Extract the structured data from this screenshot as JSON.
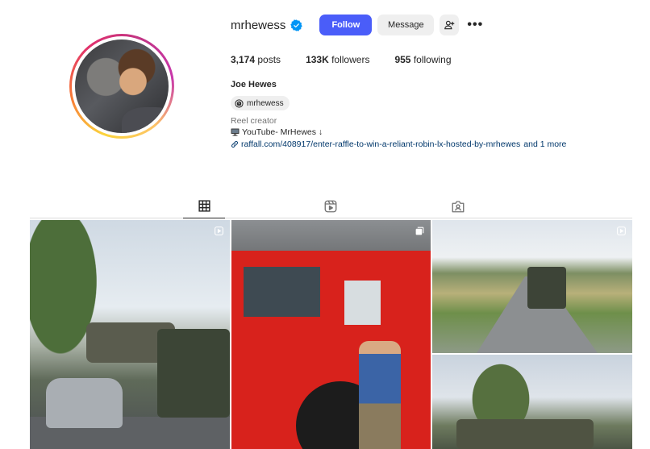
{
  "profile": {
    "username": "mrhewess",
    "full_name": "Joe Hewes",
    "threads_handle": "mrhewess",
    "category": "Reel creator",
    "bio_line": "YouTube- MrHewes ↓",
    "link": "raffall.com/408917/enter-raffle-to-win-a-reliant-robin-lx-hosted-by-mrhewes",
    "link_more": "and 1 more"
  },
  "buttons": {
    "follow": "Follow",
    "message": "Message"
  },
  "stats": {
    "posts_count": "3,174",
    "posts_label": "posts",
    "followers_count": "133K",
    "followers_label": "followers",
    "following_count": "955",
    "following_label": "following"
  },
  "tabs": [
    {
      "name": "posts",
      "icon": "grid-icon",
      "active": true
    },
    {
      "name": "reels",
      "icon": "reels-icon",
      "active": false
    },
    {
      "name": "tagged",
      "icon": "tagged-icon",
      "active": false
    }
  ],
  "grid": [
    {
      "subject": "street-tank-convoy",
      "badge": "reel-icon"
    },
    {
      "subject": "red-fire-engine",
      "badge": "carousel-icon"
    },
    {
      "subject": "country-road-convoy",
      "badge": "reel-icon"
    },
    {
      "subject": "tank-in-field",
      "badge": null
    }
  ],
  "colors": {
    "follow_button": "#4a5df9",
    "verified_badge": "#0095f6",
    "link": "#00376b",
    "secondary_button": "#efefef"
  }
}
